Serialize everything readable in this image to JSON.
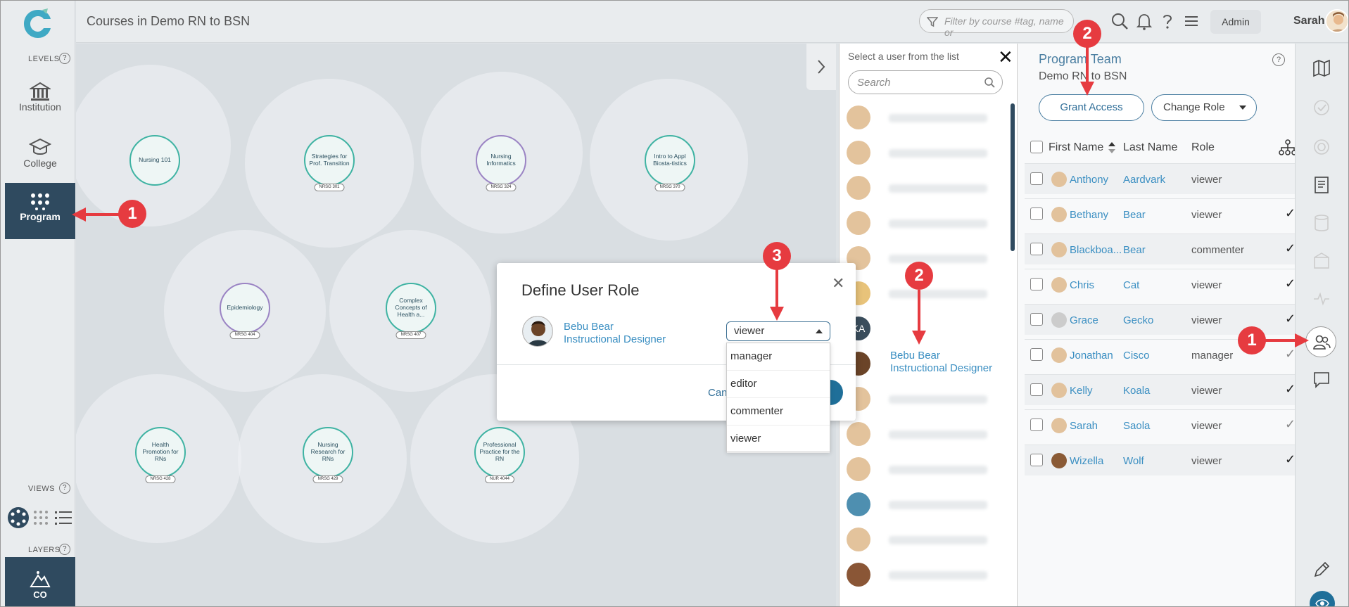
{
  "header": {
    "title": "Courses in Demo RN to BSN",
    "filter_placeholder": "Filter by course #tag, name or",
    "admin_label": "Admin",
    "user_name": "Sarah"
  },
  "leftrail": {
    "levels_label": "LEVELS",
    "views_label": "VIEWS",
    "layers_label": "LAYERS",
    "help_glyph": "?",
    "items": [
      {
        "label": "Institution",
        "icon": "institution-icon"
      },
      {
        "label": "College",
        "icon": "college-icon"
      },
      {
        "label": "Program",
        "icon": "program-icon",
        "active": true
      }
    ],
    "bottom_label": "CO"
  },
  "map": {
    "nodes": [
      {
        "label": "Nursing 101"
      },
      {
        "label": "Strategies for Prof. Transition",
        "code": "NRSG 301"
      },
      {
        "label": "Nursing Informatics",
        "code": "NRSG 324"
      },
      {
        "label": "Intro to Appl Biosta-tistics",
        "code": "NRSG 370"
      },
      {
        "label": "Epidemiology",
        "code": "NRSG 404"
      },
      {
        "label": "Complex Concepts of Health a...",
        "code": "NRSG 407"
      },
      {
        "label": "Health Promotion for RNs",
        "code": "NRSG 428"
      },
      {
        "label": "Nursing Research for RNs",
        "code": "NRSG 429"
      },
      {
        "label": "Professional Practice for the RN",
        "code": "NUR 4044"
      }
    ]
  },
  "picker": {
    "title": "Select a user from the list",
    "search_placeholder": "Search",
    "initials_avatar": "KA",
    "picked_name": "Bebu Bear",
    "picked_role": "Instructional Designer"
  },
  "team": {
    "title": "Program Team",
    "subtitle": "Demo RN to BSN",
    "grant_label": "Grant Access",
    "change_role_label": "Change Role",
    "columns": {
      "first": "First Name",
      "last": "Last Name",
      "role": "Role"
    },
    "rows": [
      {
        "first": "Anthony",
        "last": "Aardvark",
        "role": "viewer",
        "check": ""
      },
      {
        "first": "Bethany",
        "last": "Bear",
        "role": "viewer",
        "check": "✓"
      },
      {
        "first": "Blackboa...",
        "last": "Bear",
        "role": "commenter",
        "check": "✓"
      },
      {
        "first": "Chris",
        "last": "Cat",
        "role": "viewer",
        "check": "✓"
      },
      {
        "first": "Grace",
        "last": "Gecko",
        "role": "viewer",
        "check": "✓"
      },
      {
        "first": "Jonathan",
        "last": "Cisco",
        "role": "manager",
        "check": "✓",
        "light": true
      },
      {
        "first": "Kelly",
        "last": "Koala",
        "role": "viewer",
        "check": "✓"
      },
      {
        "first": "Sarah",
        "last": "Saola",
        "role": "viewer",
        "check": "✓",
        "light": true
      },
      {
        "first": "Wizella",
        "last": "Wolf",
        "role": "viewer",
        "check": "✓"
      }
    ]
  },
  "modal": {
    "title": "Define User Role",
    "user_name": "Bebu Bear",
    "user_title": "Instructional Designer",
    "selected_role": "viewer",
    "options": [
      "manager",
      "editor",
      "commenter",
      "viewer"
    ],
    "cancel_partial": "Can",
    "close_glyph": "✕"
  },
  "annotations": {
    "accent_color": "#e63b40",
    "badges": [
      "1",
      "2",
      "3",
      "2",
      "1"
    ]
  }
}
